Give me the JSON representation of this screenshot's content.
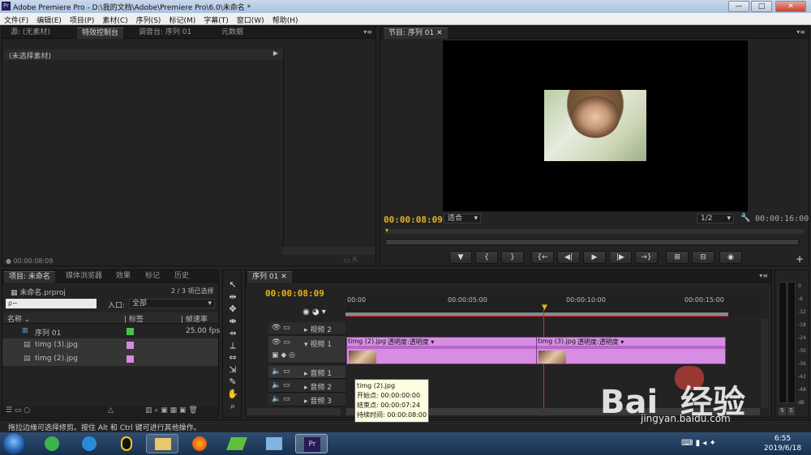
{
  "window": {
    "title": "Adobe Premiere Pro - D:\\我的文档\\Adobe\\Premiere Pro\\6.0\\未命名 *",
    "min_label": "—",
    "max_label": "□",
    "close_label": "✕"
  },
  "menu": [
    "文件(F)",
    "编辑(E)",
    "项目(P)",
    "素材(C)",
    "序列(S)",
    "标记(M)",
    "字幕(T)",
    "窗口(W)",
    "帮助(H)"
  ],
  "source_panel": {
    "tabs": [
      "源: (无素材)",
      "特效控制台",
      "调音台: 序列 01",
      "元数据"
    ],
    "active_tab": 1,
    "clip_label": "(未选择素材)",
    "timecode": "00:00:08:09"
  },
  "program_panel": {
    "tab": "节目: 序列 01",
    "timecode_current": "00:00:08:09",
    "fit_label": "适合",
    "resolution": "1/2",
    "timecode_total": "00:00:16:00",
    "buttons": [
      "▼",
      "{",
      "}",
      "{←",
      "◀|",
      "▶",
      "|▶",
      "→}",
      "⊞",
      "⊟",
      "◉"
    ],
    "add_label": "+"
  },
  "project_panel": {
    "tabs": [
      "项目: 未命名",
      "媒体浏览器",
      "效果",
      "标记",
      "历史"
    ],
    "project_file": "未命名.prproj",
    "selection_count": "2 / 3 项已选择",
    "search_placeholder": "ρ~",
    "entry_label": "入口:",
    "entry_value": "全部",
    "columns": {
      "name": "名称",
      "label": "标签",
      "framerate": "帧速率"
    },
    "items": [
      {
        "name": "序列 01",
        "color": "#4cbf4c",
        "fps": "25.00 fps"
      },
      {
        "name": "timg (3).jpg",
        "color": "#d68ae0",
        "fps": ""
      },
      {
        "name": "timg (2).jpg",
        "color": "#d68ae0",
        "fps": ""
      }
    ]
  },
  "timeline": {
    "tab": "序列 01",
    "timecode": "00:00:08:09",
    "ruler": [
      "00:00",
      "00:00:05:00",
      "00:00:10:00",
      "00:00:15:00"
    ],
    "tracks": {
      "video2": "视频 2",
      "video1": "视频 1",
      "audio1": "音频 1",
      "audio2": "音频 2",
      "audio3": "音频 3"
    },
    "clips": [
      {
        "name": "timg (2).jpg",
        "effect": "透明度:透明度 ▾"
      },
      {
        "name": "timg (3).jpg",
        "effect": "透明度:透明度 ▾"
      }
    ],
    "tooltip": {
      "name": "timg (2).jpg",
      "start": "开始点: 00:00:00:00",
      "end": "结束点: 00:00:07:24",
      "duration": "持续时间: 00:00:08:00"
    }
  },
  "meter": {
    "scale": [
      "0",
      "-6",
      "-12",
      "-18",
      "-24",
      "-30",
      "-36",
      "-42",
      "-48",
      "dB"
    ],
    "solo_left": "S",
    "solo_right": "S"
  },
  "status_bar": "拖拉边缘可选择修剪。按住 Alt 和 Ctrl 键可进行其他操作。",
  "taskbar": {
    "time": "6:55",
    "date": "2019/6/18",
    "pr_label": "Pr"
  },
  "watermark": {
    "text": "Bai  经验",
    "url": "jingyan.baidu.com"
  }
}
